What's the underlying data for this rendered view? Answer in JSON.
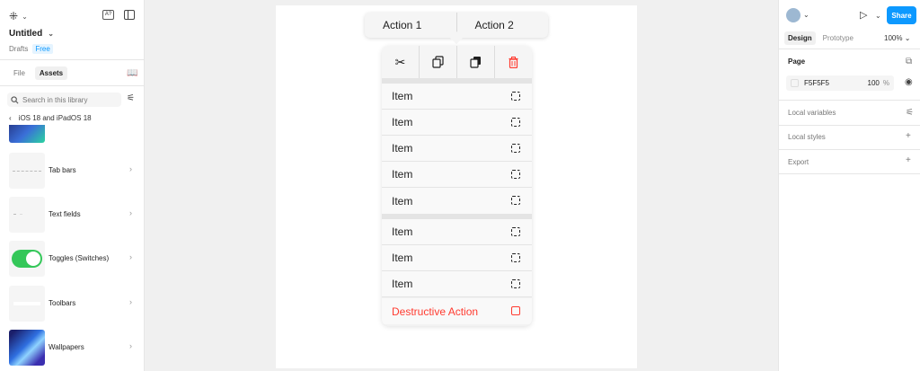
{
  "left_panel": {
    "logo_icon": "figma-logo-icon",
    "logo_glyph": "⁜",
    "kbd_badge": "A?",
    "file_title": "Untitled",
    "drafts": "Drafts",
    "plan_badge": "Free",
    "tabs": {
      "file": "File",
      "assets": "Assets"
    },
    "search_placeholder": "Search in this library",
    "breadcrumb": "iOS 18 and iPadOS 18",
    "assets": [
      {
        "label": "Tab bars"
      },
      {
        "label": "Text fields"
      },
      {
        "label": "Toggles (Switches)"
      },
      {
        "label": "Toolbars"
      },
      {
        "label": "Wallpapers"
      }
    ]
  },
  "canvas": {
    "tooltip": {
      "action1": "Action 1",
      "action2": "Action 2"
    },
    "icon_bar": [
      "scissors-icon",
      "copy-icon",
      "paste-icon",
      "trash-icon"
    ],
    "menu_items": [
      {
        "label": "Item"
      },
      {
        "label": "Item"
      },
      {
        "label": "Item"
      },
      {
        "label": "Item"
      },
      {
        "label": "Item"
      },
      {
        "label": "Item"
      },
      {
        "label": "Item"
      },
      {
        "label": "Item"
      }
    ],
    "destructive": "Destructive Action",
    "colors": {
      "destructive": "#ff3b30",
      "menu_bg": "#f9f9f9"
    }
  },
  "right_panel": {
    "share": "Share",
    "tabs": {
      "design": "Design",
      "prototype": "Prototype"
    },
    "zoom": "100%",
    "page_label": "Page",
    "page_color_hex": "F5F5F5",
    "page_opacity": "100",
    "percent": "%",
    "local_variables": "Local variables",
    "local_styles": "Local styles",
    "export": "Export",
    "accent": "#0d99ff"
  }
}
